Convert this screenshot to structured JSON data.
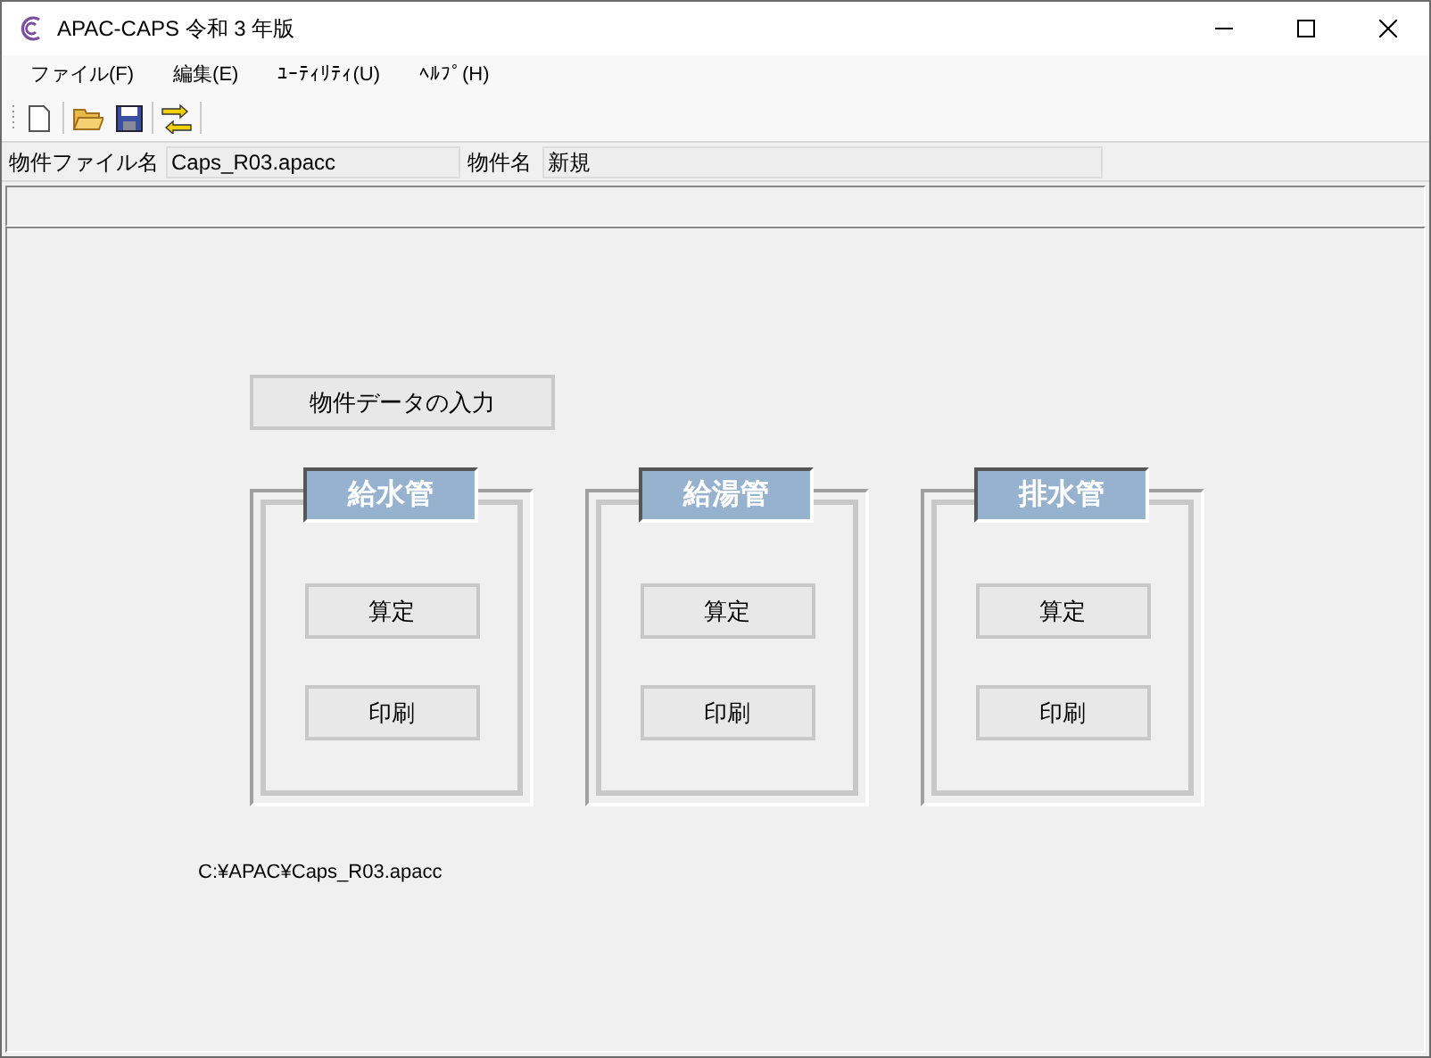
{
  "window": {
    "title": "APAC-CAPS 令和 3 年版"
  },
  "menu": [
    "ファイル(F)",
    "編集(E)",
    "ﾕｰﾃｨﾘﾃｨ(U)",
    "ﾍﾙﾌﾟ(H)"
  ],
  "info": {
    "file_label": "物件ファイル名",
    "file_value": "Caps_R03.apacc",
    "name_label": "物件名",
    "name_value": "新規"
  },
  "input_button": "物件データの入力",
  "panels": [
    {
      "title": "給水管",
      "buttons": [
        "算定",
        "印刷"
      ]
    },
    {
      "title": "給湯管",
      "buttons": [
        "算定",
        "印刷"
      ]
    },
    {
      "title": "排水管",
      "buttons": [
        "算定",
        "印刷"
      ]
    }
  ],
  "path": "C:¥APAC¥Caps_R03.apacc"
}
